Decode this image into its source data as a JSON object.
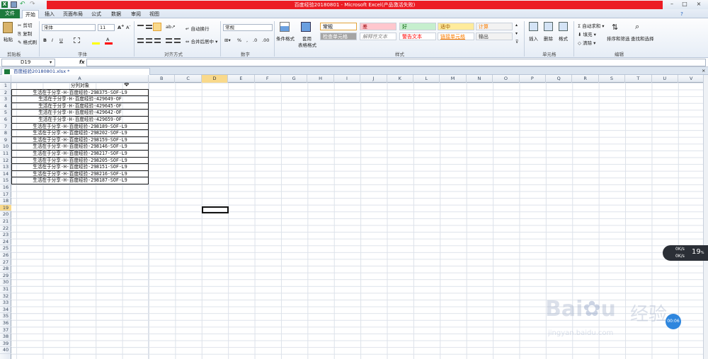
{
  "window": {
    "title": "百度经验20180801 - Microsoft Excel(产品激活失败)",
    "controls": [
      "minimize",
      "maximize",
      "close"
    ]
  },
  "tabs": [
    {
      "label": "文件"
    },
    {
      "label": "开始"
    },
    {
      "label": "插入"
    },
    {
      "label": "页面布局"
    },
    {
      "label": "公式"
    },
    {
      "label": "数据"
    },
    {
      "label": "审阅"
    },
    {
      "label": "视图"
    }
  ],
  "ribbon": {
    "clipboard": {
      "label": "剪贴板",
      "paste": "粘贴",
      "cut": "剪切",
      "copy": "复制",
      "format_painter": "格式刷"
    },
    "font": {
      "label": "字体",
      "name": "宋体",
      "size": "11"
    },
    "alignment": {
      "label": "对齐方式",
      "wrap": "自动换行",
      "merge": "合并后居中"
    },
    "number": {
      "label": "数字",
      "format": "常规"
    },
    "styles": {
      "label": "样式",
      "conditional": "条件格式",
      "table": "套用",
      "table2": "表格格式",
      "cells": [
        {
          "text": "常规",
          "bg": "#ffffff",
          "color": "#000000"
        },
        {
          "text": "差",
          "bg": "#ffc7ce",
          "color": "#9c0006"
        },
        {
          "text": "好",
          "bg": "#c6efce",
          "color": "#006100"
        },
        {
          "text": "适中",
          "bg": "#ffeb9c",
          "color": "#9c5700"
        },
        {
          "text": "计算",
          "bg": "#f2f2f2",
          "color": "#fa7d00"
        },
        {
          "text": "检查单元格",
          "bg": "#a5a5a5",
          "color": "#ffffff"
        },
        {
          "text": "解释性文本",
          "bg": "#ffffff",
          "color": "#7f7f7f"
        },
        {
          "text": "警告文本",
          "bg": "#ffffff",
          "color": "#ff0000"
        },
        {
          "text": "链接单元格",
          "bg": "#ffffff",
          "color": "#fa7d00"
        },
        {
          "text": "输出",
          "bg": "#f2f2f2",
          "color": "#3f3f3f"
        }
      ]
    },
    "cells_group": {
      "label": "单元格",
      "insert": "插入",
      "delete": "删除",
      "format": "格式"
    },
    "editing": {
      "label": "编辑",
      "autosum": "自动求和",
      "fill": "填充",
      "clear": "清除",
      "sort": "排序和筛选",
      "find": "查找和选择"
    }
  },
  "formula_bar": {
    "name_box": "D19",
    "fx": "fx",
    "value": ""
  },
  "workbook": {
    "tab": "百度经验20180801.xlsx *"
  },
  "grid": {
    "columns": [
      "A",
      "B",
      "C",
      "D",
      "E",
      "F",
      "G",
      "H",
      "I",
      "J",
      "K",
      "L",
      "M",
      "N",
      "O",
      "P",
      "Q",
      "R",
      "S",
      "T",
      "U",
      "V"
    ],
    "selected_column": "D",
    "selected_row": 19,
    "row_count": 40,
    "header": "分列对象",
    "values": [
      "生活在于分享-H-百度经验-298375-SOF-L9",
      "生活在于分享-H-百度经验-429649-OF",
      "生活在于分享-H-百度经验-429645-OF",
      "生活在于分享-H-百度经验-429642-OF",
      "生活在于分享-H-百度经验-429659-OF",
      "生活在于分享-H-百度经验-298189-SOF-L9",
      "生活在于分享-H-百度经验-298202-SOF-L9",
      "生活在于分享-H-百度经验-298159-SOF-L9",
      "生活在于分享-H-百度经验-298146-SOF-L9",
      "生活在于分享-H-百度经验-298217-SOF-L9",
      "生活在于分享-H-百度经验-298205-SOF-L9",
      "生活在于分享-H-百度经验-298151-SOF-L9",
      "生活在于分享-H-百度经验-298216-SOF-L9",
      "生活在于分享-H-百度经验-298187-SOF-L9"
    ]
  },
  "overlay": {
    "net_up": "0K/s",
    "net_down": "0K/s",
    "percent": "19",
    "percent_unit": "%",
    "timer": "00:06",
    "watermark_url": "jingyan.baidu.com",
    "watermark_text": "经验"
  }
}
